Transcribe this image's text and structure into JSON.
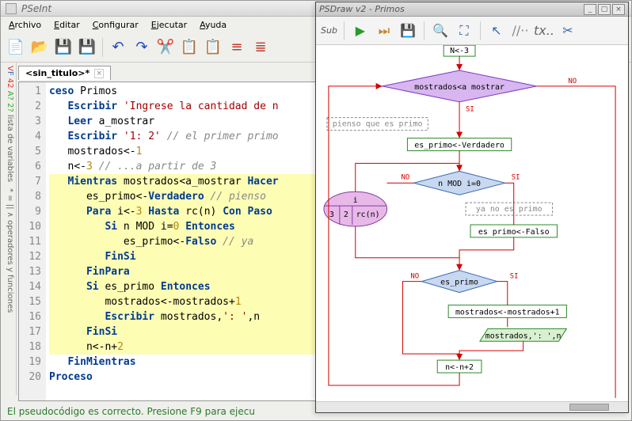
{
  "main": {
    "title": "PSeInt",
    "menu": [
      "Archivo",
      "Editar",
      "Configurar",
      "Ejecutar",
      "Ayuda"
    ],
    "tab": {
      "name": "<sin_titulo>*",
      "close": "×"
    },
    "sidebar_labels": [
      "lista de variables",
      "operadores y funciones"
    ],
    "sidebar_prefix": "VF 42 A? 2?",
    "status": "El pseudocódigo es correcto. Presione F9 para ejecu",
    "code": [
      {
        "n": 1,
        "hl": false,
        "segs": [
          [
            "kw",
            "ceso"
          ],
          [
            "op",
            " Primos"
          ]
        ]
      },
      {
        "n": 2,
        "hl": false,
        "segs": [
          [
            "kw",
            "   Escribir "
          ],
          [
            "str",
            "'Ingrese la cantidad de n"
          ]
        ]
      },
      {
        "n": 3,
        "hl": false,
        "segs": [
          [
            "kw",
            "   Leer"
          ],
          [
            "op",
            " a_mostrar"
          ]
        ]
      },
      {
        "n": 4,
        "hl": false,
        "segs": [
          [
            "kw",
            "   Escribir "
          ],
          [
            "str",
            "'1: 2' "
          ],
          [
            "cmt",
            "// el primer primo"
          ]
        ]
      },
      {
        "n": 5,
        "hl": false,
        "segs": [
          [
            "op",
            "   mostrados"
          ],
          [
            "op",
            "<-"
          ],
          [
            "num",
            "1"
          ]
        ]
      },
      {
        "n": 6,
        "hl": false,
        "segs": [
          [
            "op",
            "   n"
          ],
          [
            "op",
            "<-"
          ],
          [
            "num",
            "3 "
          ],
          [
            "cmt",
            "// ...a partir de 3"
          ]
        ]
      },
      {
        "n": 7,
        "hl": true,
        "segs": [
          [
            "kw",
            "   Mientras"
          ],
          [
            "op",
            " mostrados<a_mostrar "
          ],
          [
            "kw",
            "Hacer"
          ]
        ]
      },
      {
        "n": 8,
        "hl": true,
        "segs": [
          [
            "op",
            "      es_primo"
          ],
          [
            "op",
            "<-"
          ],
          [
            "kw",
            "Verdadero "
          ],
          [
            "cmt",
            "// pienso"
          ]
        ]
      },
      {
        "n": 9,
        "hl": true,
        "segs": [
          [
            "kw",
            "      Para"
          ],
          [
            "op",
            " i"
          ],
          [
            "op",
            "<-"
          ],
          [
            "num",
            "3 "
          ],
          [
            "kw",
            "Hasta"
          ],
          [
            "op",
            " rc(n) "
          ],
          [
            "kw",
            "Con Paso"
          ]
        ]
      },
      {
        "n": 10,
        "hl": true,
        "segs": [
          [
            "kw",
            "         Si"
          ],
          [
            "op",
            " n MOD i="
          ],
          [
            "num",
            "0 "
          ],
          [
            "kw",
            "Entonces"
          ]
        ]
      },
      {
        "n": 11,
        "hl": true,
        "segs": [
          [
            "op",
            "            es_primo"
          ],
          [
            "op",
            "<-"
          ],
          [
            "kw",
            "Falso "
          ],
          [
            "cmt",
            "// ya"
          ]
        ]
      },
      {
        "n": 12,
        "hl": true,
        "segs": [
          [
            "kw",
            "         FinSi"
          ]
        ]
      },
      {
        "n": 13,
        "hl": true,
        "segs": [
          [
            "kw",
            "      FinPara"
          ]
        ]
      },
      {
        "n": 14,
        "hl": true,
        "segs": [
          [
            "kw",
            "      Si"
          ],
          [
            "op",
            " es_primo "
          ],
          [
            "kw",
            "Entonces"
          ]
        ]
      },
      {
        "n": 15,
        "hl": true,
        "segs": [
          [
            "op",
            "         mostrados"
          ],
          [
            "op",
            "<-mostrados+"
          ],
          [
            "num",
            "1"
          ]
        ]
      },
      {
        "n": 16,
        "hl": true,
        "segs": [
          [
            "kw",
            "         Escribir"
          ],
          [
            "op",
            " mostrados,"
          ],
          [
            "str",
            "': '"
          ],
          [
            "op",
            ",n"
          ]
        ]
      },
      {
        "n": 17,
        "hl": true,
        "segs": [
          [
            "kw",
            "      FinSi"
          ]
        ]
      },
      {
        "n": 18,
        "hl": true,
        "segs": [
          [
            "op",
            "      n"
          ],
          [
            "op",
            "<-n+"
          ],
          [
            "num",
            "2"
          ]
        ]
      },
      {
        "n": 19,
        "hl": false,
        "segs": [
          [
            "kw",
            "   FinMientras"
          ]
        ]
      },
      {
        "n": 20,
        "hl": false,
        "segs": [
          [
            "kw",
            "Proceso"
          ]
        ]
      }
    ]
  },
  "draw": {
    "title": "PSDraw v2 - Primos",
    "sub_label": "Sub",
    "toolbar_icons": [
      "play",
      "step",
      "save",
      "zoom",
      "fullscreen",
      "cursor",
      "comment",
      "tx",
      "scissors"
    ],
    "nodes": {
      "n_init": "N<-3",
      "cond_main": "mostrados<a mostrar",
      "note1": "pienso que es primo",
      "asg1": "es_primo<-Verdadero",
      "cond_mod": "n MOD i=0",
      "for_head": "i",
      "for_body1": "3",
      "for_body2": "2",
      "for_body3": "rc(n)",
      "note2": "ya no es primo",
      "asg2": "es primo<-Falso",
      "cond_esprimo": "es_primo",
      "asg3": "mostrados<-mostrados+1",
      "io1": "mostrados,': ',n",
      "asg4": "n<-n+2",
      "no_label": "NO",
      "si_label": "SI"
    }
  }
}
